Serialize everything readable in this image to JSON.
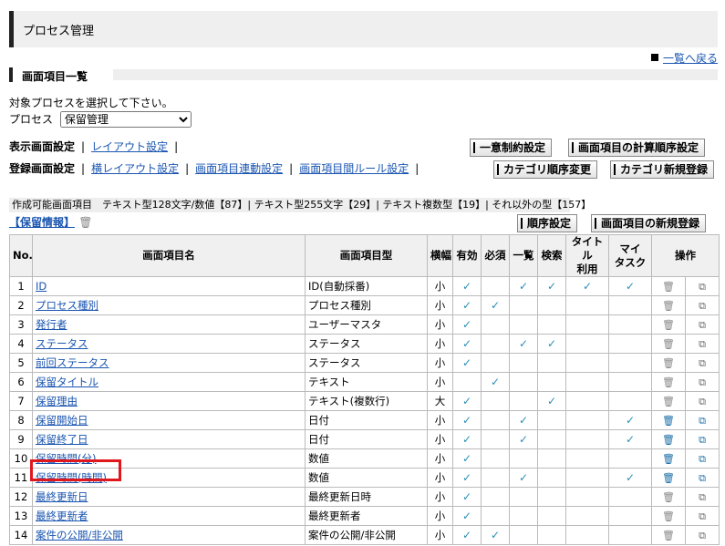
{
  "header": {
    "title": "プロセス管理",
    "back_link": "一覧へ戻る"
  },
  "section": {
    "title": "画面項目一覧"
  },
  "process": {
    "prompt": "対象プロセスを選択して下さい。",
    "label": "プロセス",
    "selected": "保留管理"
  },
  "display_links": {
    "label": "表示画面設定",
    "items": [
      "レイアウト設定"
    ]
  },
  "register_links": {
    "label": "登録画面設定",
    "items": [
      "横レイアウト設定",
      "画面項目連動設定",
      "画面項目間ルール設定"
    ]
  },
  "buttons": {
    "unique": "一意制約設定",
    "calc_order": "画面項目の計算順序設定",
    "cat_order": "カテゴリ順序変更",
    "cat_new": "カテゴリ新規登録",
    "order": "順序設定",
    "item_new": "画面項目の新規登録"
  },
  "types_bar": "作成可能画面項目　テキスト型128文字/数値【87】| テキスト型255文字【29】| テキスト複数型【19】| それ以外の型【157】",
  "group": {
    "label": "【保留情報】"
  },
  "table": {
    "headers": {
      "no": "No.",
      "name": "画面項目名",
      "type": "画面項目型",
      "width": "横幅",
      "valid": "有効",
      "required": "必須",
      "list": "一覧",
      "search": "検索",
      "title_use": "タイトル\n利用",
      "my_task": "マイ\nタスク",
      "ops": "操作"
    },
    "rows": [
      {
        "no": "1",
        "name": "ID",
        "type": "ID(自動採番)",
        "width": "小",
        "valid": "✓",
        "required": "",
        "list": "✓",
        "search": "✓",
        "title_use": "✓",
        "my_task": "✓"
      },
      {
        "no": "2",
        "name": "プロセス種別",
        "type": "プロセス種別",
        "width": "小",
        "valid": "✓",
        "required": "✓",
        "list": "",
        "search": "",
        "title_use": "",
        "my_task": ""
      },
      {
        "no": "3",
        "name": "発行者",
        "type": "ユーザーマスタ",
        "width": "小",
        "valid": "✓",
        "required": "",
        "list": "",
        "search": "",
        "title_use": "",
        "my_task": ""
      },
      {
        "no": "4",
        "name": "ステータス",
        "type": "ステータス",
        "width": "小",
        "valid": "✓",
        "required": "",
        "list": "✓",
        "search": "✓",
        "title_use": "",
        "my_task": ""
      },
      {
        "no": "5",
        "name": "前回ステータス",
        "type": "ステータス",
        "width": "小",
        "valid": "✓",
        "required": "",
        "list": "",
        "search": "",
        "title_use": "",
        "my_task": ""
      },
      {
        "no": "6",
        "name": "保留タイトル",
        "type": "テキスト",
        "width": "小",
        "valid": "",
        "required": "✓",
        "list": "",
        "search": "",
        "title_use": "",
        "my_task": ""
      },
      {
        "no": "7",
        "name": "保留理由",
        "type": "テキスト(複数行)",
        "width": "大",
        "valid": "✓",
        "required": "",
        "list": "",
        "search": "✓",
        "title_use": "",
        "my_task": ""
      },
      {
        "no": "8",
        "name": "保留開始日",
        "type": "日付",
        "width": "小",
        "valid": "✓",
        "required": "",
        "list": "✓",
        "search": "",
        "title_use": "",
        "my_task": "✓"
      },
      {
        "no": "9",
        "name": "保留終了日",
        "type": "日付",
        "width": "小",
        "valid": "✓",
        "required": "",
        "list": "✓",
        "search": "",
        "title_use": "",
        "my_task": "✓"
      },
      {
        "no": "10",
        "name": "保留時間(分)",
        "type": "数値",
        "width": "小",
        "valid": "✓",
        "required": "",
        "list": "",
        "search": "",
        "title_use": "",
        "my_task": ""
      },
      {
        "no": "11",
        "name": "保留時間(時間)",
        "type": "数値",
        "width": "小",
        "valid": "✓",
        "required": "",
        "list": "✓",
        "search": "",
        "title_use": "",
        "my_task": "✓"
      },
      {
        "no": "12",
        "name": "最終更新日",
        "type": "最終更新日時",
        "width": "小",
        "valid": "✓",
        "required": "",
        "list": "",
        "search": "",
        "title_use": "",
        "my_task": ""
      },
      {
        "no": "13",
        "name": "最終更新者",
        "type": "最終更新者",
        "width": "小",
        "valid": "✓",
        "required": "",
        "list": "",
        "search": "",
        "title_use": "",
        "my_task": ""
      },
      {
        "no": "14",
        "name": "案件の公開/非公開",
        "type": "案件の公開/非公開",
        "width": "小",
        "valid": "✓",
        "required": "✓",
        "list": "",
        "search": "",
        "title_use": "",
        "my_task": ""
      }
    ],
    "active_ops_rows": [
      "8",
      "9",
      "10",
      "11"
    ]
  },
  "icons": {
    "delete": "trash-icon",
    "copy": "copy-icon",
    "bullet": "square-bullet-icon"
  },
  "colors": {
    "link": "#1a55b0",
    "check": "#2a8fb8",
    "highlight": "#e0181e"
  }
}
